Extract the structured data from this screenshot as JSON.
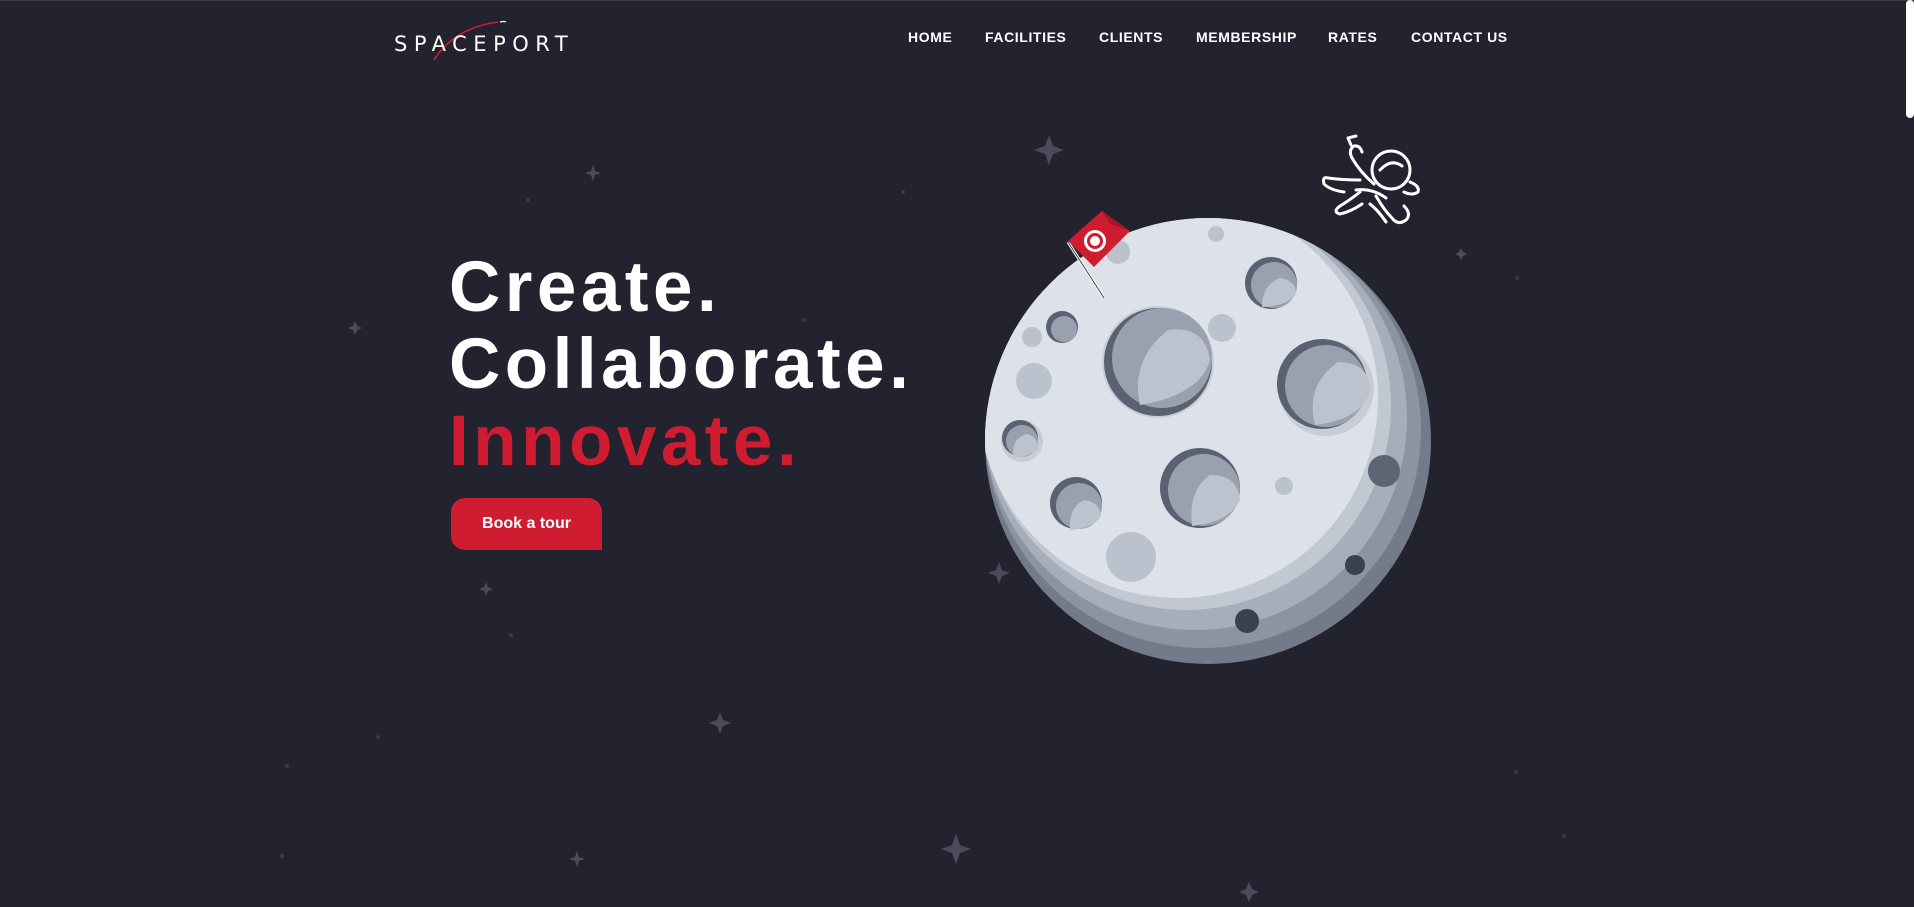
{
  "brand": {
    "logo_text": "SPACEPORT"
  },
  "nav": {
    "items": [
      {
        "label": "HOME"
      },
      {
        "label": "FACILITIES"
      },
      {
        "label": "CLIENTS"
      },
      {
        "label": "MEMBERSHIP"
      },
      {
        "label": "RATES"
      },
      {
        "label": "CONTACT US"
      }
    ]
  },
  "hero": {
    "line1": "Create.",
    "line2": "Collaborate.",
    "line3": "Innovate.",
    "cta_label": "Book a tour"
  },
  "colors": {
    "background": "#232330",
    "accent": "#d01c30",
    "text": "#ffffff",
    "moon_light": "#dfe3eb",
    "moon_mid": "#a8afbd",
    "moon_dark": "#6e7585"
  },
  "icons": {
    "astronaut": "astronaut-icon",
    "flag": "flag-icon",
    "star": "star-icon"
  }
}
